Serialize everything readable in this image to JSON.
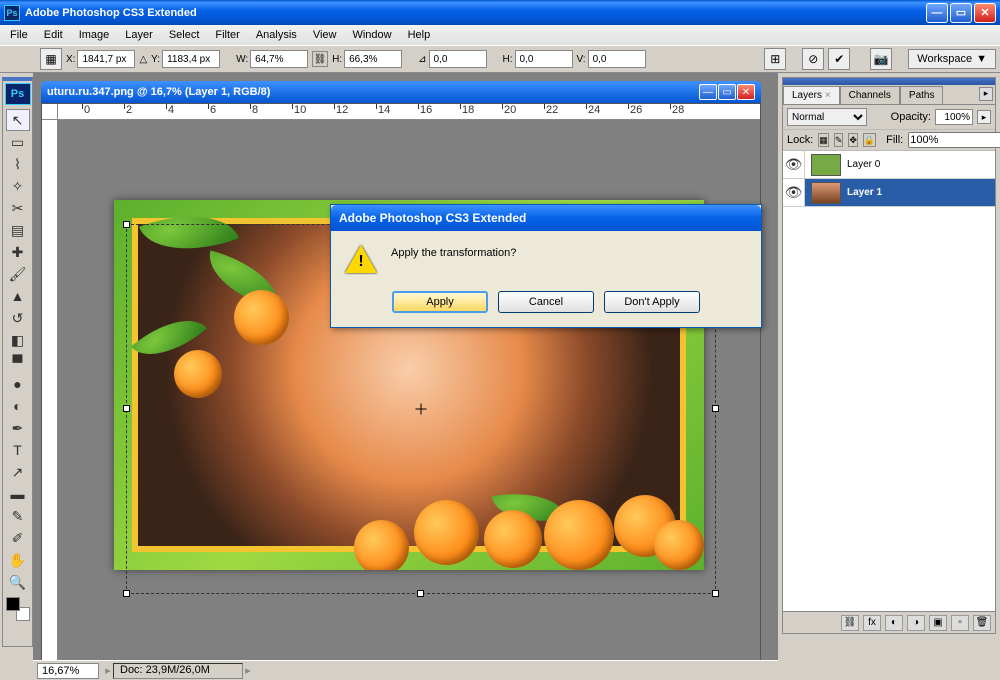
{
  "app": {
    "title": "Adobe Photoshop CS3 Extended"
  },
  "menu": {
    "items": [
      "File",
      "Edit",
      "Image",
      "Layer",
      "Select",
      "Filter",
      "Analysis",
      "View",
      "Window",
      "Help"
    ]
  },
  "options": {
    "x": "1841,7 px",
    "y": "1183,4 px",
    "w": "64,7%",
    "h": "66,3%",
    "angle": "0,0",
    "hskew": "0,0",
    "vskew": "0,0",
    "workspace": "Workspace"
  },
  "document": {
    "title": "uturu.ru.347.png @ 16,7% (Layer 1, RGB/8)",
    "ruler_marks": [
      "0",
      "2",
      "4",
      "6",
      "8",
      "10",
      "12",
      "14",
      "16",
      "18",
      "20",
      "22",
      "24",
      "26",
      "28"
    ]
  },
  "status": {
    "zoom": "16,67%",
    "doc": "Doc: 23,9M/26,0M"
  },
  "dialog": {
    "title": "Adobe Photoshop CS3 Extended",
    "message": "Apply the transformation?",
    "apply": "Apply",
    "cancel": "Cancel",
    "dont": "Don't Apply"
  },
  "panels": {
    "tabs": {
      "layers": "Layers",
      "channels": "Channels",
      "paths": "Paths"
    },
    "blend_mode": "Normal",
    "opacity_label": "Opacity:",
    "opacity": "100%",
    "lock_label": "Lock:",
    "fill_label": "Fill:",
    "fill": "100%",
    "layers": [
      {
        "name": "Layer 0",
        "selected": false
      },
      {
        "name": "Layer 1",
        "selected": true
      }
    ]
  }
}
